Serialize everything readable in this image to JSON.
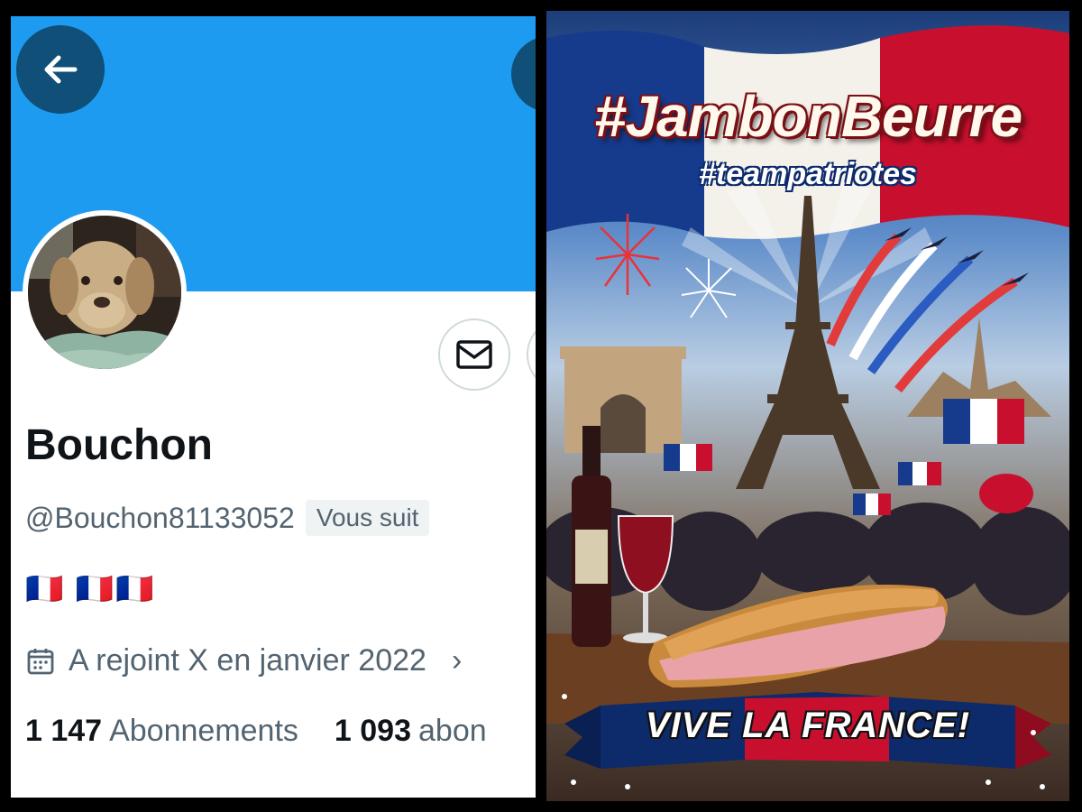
{
  "profile": {
    "display_name": "Bouchon",
    "handle": "@Bouchon81133052",
    "follows_you_badge": "Vous suit",
    "bio": "🇫🇷 🇫🇷🇫🇷",
    "joined": "A rejoint X en janvier 2022",
    "following_count": "1 147",
    "following_label": "Abonnements",
    "followers_count": "1 093",
    "followers_label": "abon",
    "banner_color": "#1d9bf0",
    "icons": [
      "back-arrow-icon",
      "mail-icon",
      "calendar-icon",
      "chevron-right-icon"
    ]
  },
  "poster": {
    "hashtag_main": "#JambonBeurre",
    "hashtag_sub": "#teampatriotes",
    "slogan": "VIVE LA FRANCE!",
    "colors": {
      "blue": "#0d2a6b",
      "white": "#ffffff",
      "red": "#c8102e"
    }
  }
}
